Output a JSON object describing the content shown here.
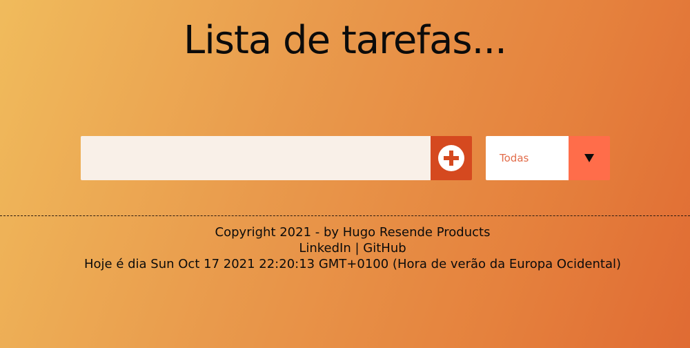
{
  "header": {
    "title": "Lista de tarefas..."
  },
  "todo_form": {
    "input_value": "",
    "input_placeholder": "",
    "add_icon": "plus-circle-icon",
    "filter": {
      "selected": "Todas",
      "arrow_icon": "triangle-down-icon"
    }
  },
  "footer": {
    "copyright": "Copyright 2021 - by Hugo Resende Products",
    "linkedin_label": "LinkedIn",
    "separator": " | ",
    "github_label": "GitHub",
    "date_text": "Hoje é dia Sun Oct 17 2021 22:20:13 GMT+0100 (Hora de verão da Europa Ocidental)"
  },
  "colors": {
    "input_bg": "#f9f0e8",
    "add_button_bg": "#d5491f",
    "filter_value_text": "#e26c4a",
    "filter_arrow_bg": "#ff6d4a"
  }
}
